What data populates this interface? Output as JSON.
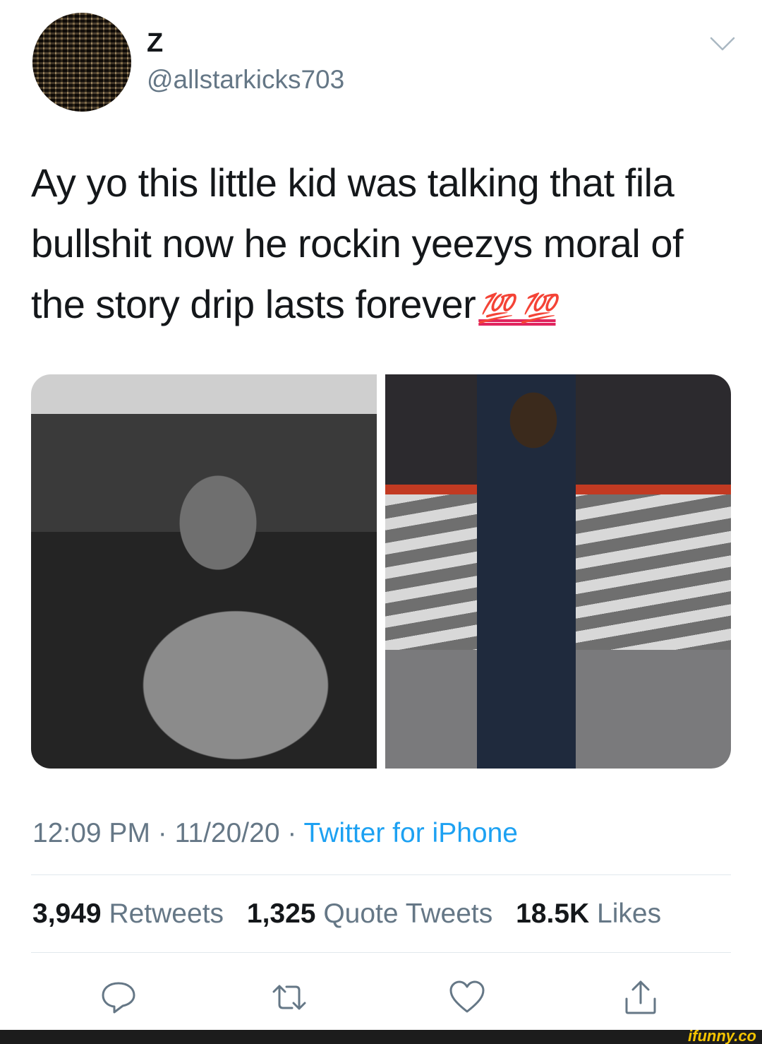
{
  "author": {
    "display_name": "Z",
    "handle": "@allstarkicks703",
    "avatar_icon": "avatar-photo"
  },
  "tweet": {
    "text": "Ay yo this little kid was talking that fila bullshit now he rockin yeezys moral of the story drip lasts forever",
    "emoji": "💯 💯"
  },
  "media": {
    "images": [
      "photo-left",
      "photo-right"
    ]
  },
  "meta": {
    "time": "12:09 PM",
    "separator1": " · ",
    "date": "11/20/20",
    "separator2": " · ",
    "source": "Twitter for iPhone"
  },
  "stats": {
    "retweets_count": "3,949",
    "retweets_label": "Retweets",
    "quotes_count": "1,325",
    "quotes_label": "Quote Tweets",
    "likes_count": "18.5K",
    "likes_label": "Likes"
  },
  "actions": [
    "reply-icon",
    "retweet-icon",
    "like-icon",
    "share-icon"
  ],
  "watermark": "ifunny.co",
  "colors": {
    "text": "#14171a",
    "secondary": "#657786",
    "link": "#1da1f2",
    "divider": "#e1e8ed"
  }
}
